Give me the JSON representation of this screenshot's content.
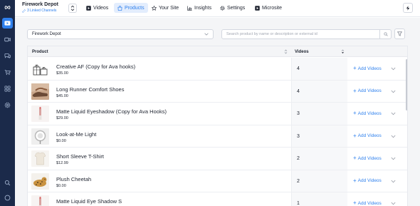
{
  "header": {
    "business_name": "Firework Depot",
    "linked_channels": "3 Linked Channels",
    "tabs": [
      {
        "label": "Videos",
        "icon": "video-play-icon",
        "active": false
      },
      {
        "label": "Products",
        "icon": "shopping-bag-icon",
        "active": true
      },
      {
        "label": "Your Site",
        "icon": "star-icon",
        "active": false
      },
      {
        "label": "Insights",
        "icon": "bar-chart-icon",
        "active": false
      },
      {
        "label": "Settings",
        "icon": "gear-icon",
        "active": false
      },
      {
        "label": "Microsite",
        "icon": "microsite-play-icon",
        "active": false
      }
    ]
  },
  "sidebar": {
    "items": [
      "logo-icon",
      "videos-nav-icon",
      "camera-nav-icon",
      "chat-nav-icon",
      "cart-nav-icon",
      "apps-grid-icon",
      "settings-nav-icon",
      "search-nav-icon",
      "help-nav-icon"
    ],
    "active_index": 1
  },
  "filters": {
    "channel": "Firework Depot",
    "search_placeholder": "Search product by name or description or external id"
  },
  "table": {
    "columns": {
      "product": "Product",
      "videos": "Videos"
    },
    "add_label": "Add Videos",
    "rows": [
      {
        "name": "Creative AF (Copy for Ava hooks)",
        "price": "$35.00",
        "videos": "4",
        "thumb": "gift-box-illustration"
      },
      {
        "name": "Long Runner Comfort Shoes",
        "price": "$45.00",
        "videos": "4",
        "thumb": "shoes-photo"
      },
      {
        "name": "Matte Liquid Eyeshadow (Copy for Ava Hooks)",
        "price": "$29.00",
        "videos": "3",
        "thumb": "lipstick-photo"
      },
      {
        "name": "Look-at-Me Light",
        "price": "$0.00",
        "videos": "3",
        "thumb": "ring-light-photo"
      },
      {
        "name": "Short Sleeve T-Shirt",
        "price": "$12.99",
        "videos": "2",
        "thumb": "tshirt-photo"
      },
      {
        "name": "Plush Cheetah",
        "price": "$0.00",
        "videos": "2",
        "thumb": "cheetah-photo"
      },
      {
        "name": "Matte Liquid Eye Shadow S",
        "price": "",
        "videos": "1",
        "thumb": "lipstick-photo"
      }
    ]
  },
  "colors": {
    "sidebar": "#1b2a4a",
    "accent": "#2f80ed",
    "active_tab_bg": "#e3edfd"
  }
}
